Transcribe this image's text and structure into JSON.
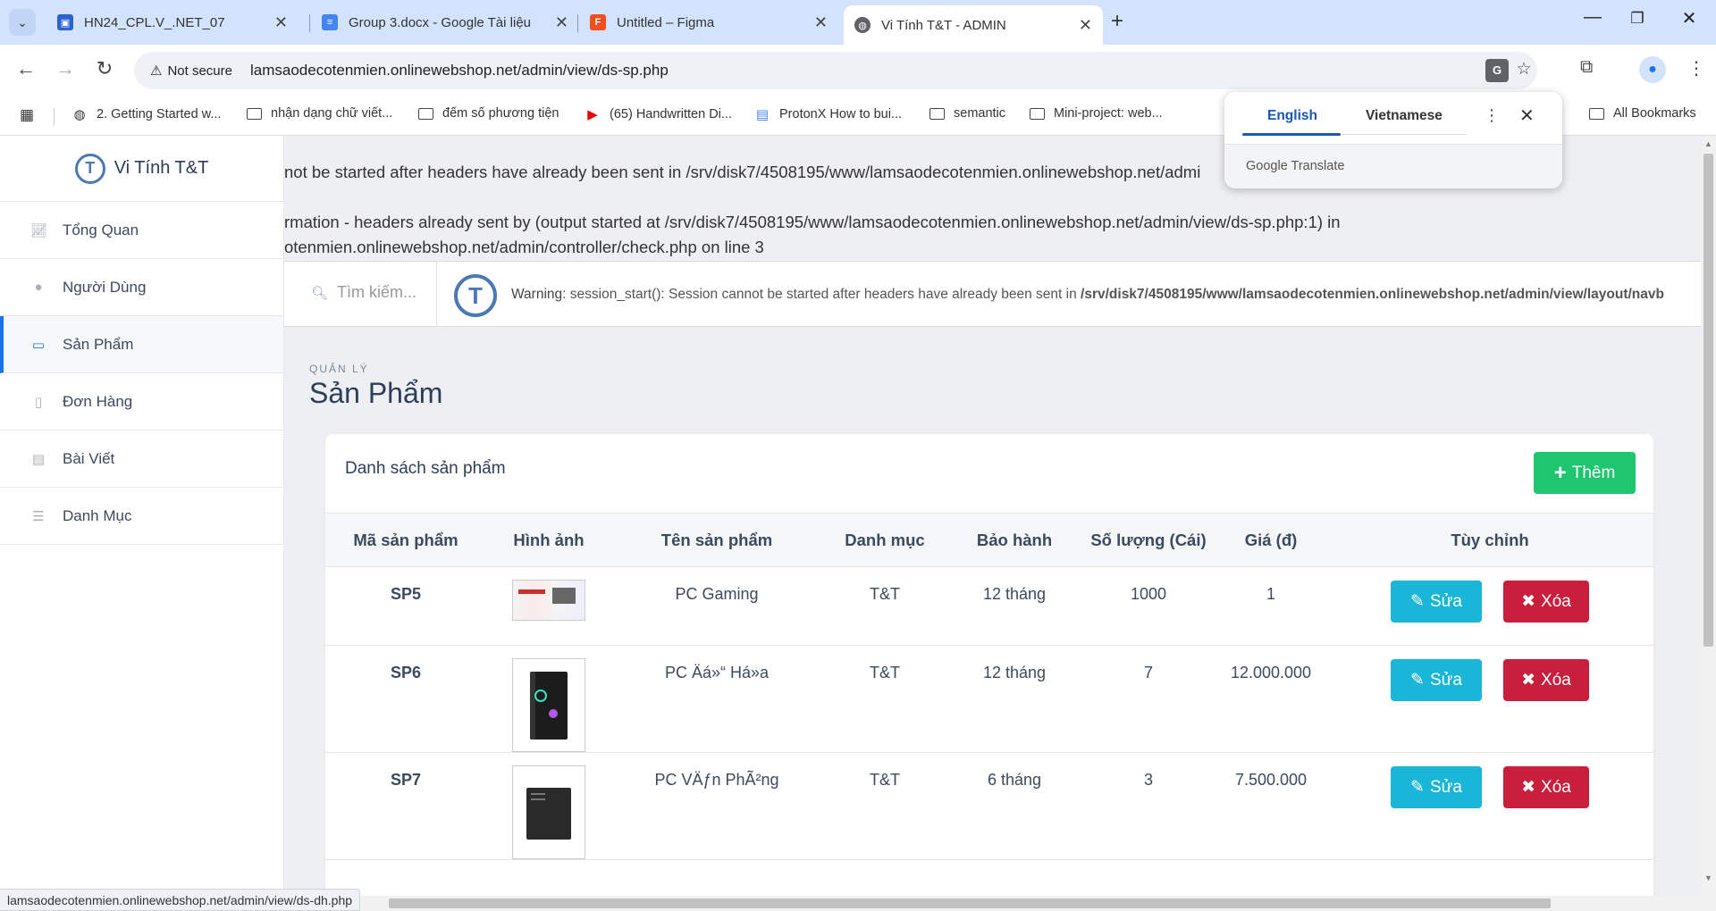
{
  "browser": {
    "tabs": [
      {
        "title": "HN24_CPL.V_.NET_07",
        "icon": "doc-blue-icon",
        "color": "#2b62d1"
      },
      {
        "title": "Group 3.docx - Google Tài liệu",
        "icon": "docs-icon",
        "color": "#4285f4"
      },
      {
        "title": "Untitled – Figma",
        "icon": "figma-icon",
        "color": "#f24e1e"
      },
      {
        "title": "Vi Tính T&T - ADMIN",
        "icon": "globe-icon",
        "color": "#5f6368"
      }
    ],
    "not_secure": "Not secure",
    "url": "lamsaodecotenmien.onlinewebshop.net/admin/view/ds-sp.php",
    "bookmarks": [
      {
        "label": "2. Getting Started w...",
        "icon": "globe-icon"
      },
      {
        "label": "nhận dạng chữ viết...",
        "icon": "folder-icon"
      },
      {
        "label": "đếm số phương tiện",
        "icon": "folder-icon"
      },
      {
        "label": "(65) Handwritten Di...",
        "icon": "youtube-icon"
      },
      {
        "label": "ProtonX How to bui...",
        "icon": "docs-icon"
      },
      {
        "label": "semantic",
        "icon": "folder-icon"
      },
      {
        "label": "Mini-project: web...",
        "icon": "folder-icon"
      }
    ],
    "all_bookmarks": "All Bookmarks",
    "status_url": "lamsaodecotenmien.onlinewebshop.net/admin/view/ds-dh.php"
  },
  "translate": {
    "lang_source": "English",
    "lang_target": "Vietnamese",
    "brand": "Google Translate"
  },
  "sidebar": {
    "brand": "Vi Tính T&T",
    "items": [
      {
        "label": "Tổng Quan",
        "icon": "chart-icon"
      },
      {
        "label": "Người Dùng",
        "icon": "user-icon"
      },
      {
        "label": "Sản Phẩm",
        "icon": "monitor-icon"
      },
      {
        "label": "Đơn Hàng",
        "icon": "file-icon"
      },
      {
        "label": "Bài Viết",
        "icon": "post-icon"
      },
      {
        "label": "Danh Mục",
        "icon": "list-icon"
      }
    ]
  },
  "errors": {
    "line1": "not be started after headers have already been sent in /srv/disk7/4508195/www/lamsaodecotenmien.onlinewebshop.net/admi",
    "line2": "rmation - headers already sent by (output started at /srv/disk7/4508195/www/lamsaodecotenmien.onlinewebshop.net/admin/view/ds-sp.php:1) in",
    "line3": "otenmien.onlinewebshop.net/admin/controller/check.php on line 3"
  },
  "topnav": {
    "search_placeholder": "Tìm kiếm...",
    "warning_label": "Warning",
    "warning_text": ": session_start(): Session cannot be started after headers have already been sent in ",
    "warning_path": "/srv/disk7/4508195/www/lamsaodecotenmien.onlinewebshop.net/admin/view/layout/navb"
  },
  "page": {
    "kicker": "QUẢN LÝ",
    "title": "Sản Phẩm"
  },
  "card": {
    "title": "Danh sách sản phẩm",
    "add_label": "Thêm",
    "columns": [
      "Mã sản phẩm",
      "Hình ảnh",
      "Tên sản phẩm",
      "Danh mục",
      "Bảo hành",
      "Số lượng (Cái)",
      "Giá (đ)",
      "Tùy chỉnh"
    ],
    "edit_label": "Sửa",
    "delete_label": "Xóa",
    "rows": [
      {
        "id": "SP5",
        "name": "PC Gaming",
        "category": "T&T",
        "warranty": "12 tháng",
        "qty": "1000",
        "price": "1"
      },
      {
        "id": "SP6",
        "name": "PC Äá»“ Há»a",
        "category": "T&T",
        "warranty": "12 tháng",
        "qty": "7",
        "price": "12.000.000"
      },
      {
        "id": "SP7",
        "name": "PC VÄƒn PhÃ²ng",
        "category": "T&T",
        "warranty": "6 tháng",
        "qty": "3",
        "price": "7.500.000"
      }
    ]
  },
  "colors": {
    "accent": "#1a73e8",
    "add_button": "#1fc66f",
    "edit_button": "#1ab6d8",
    "delete_button": "#c8203c"
  }
}
